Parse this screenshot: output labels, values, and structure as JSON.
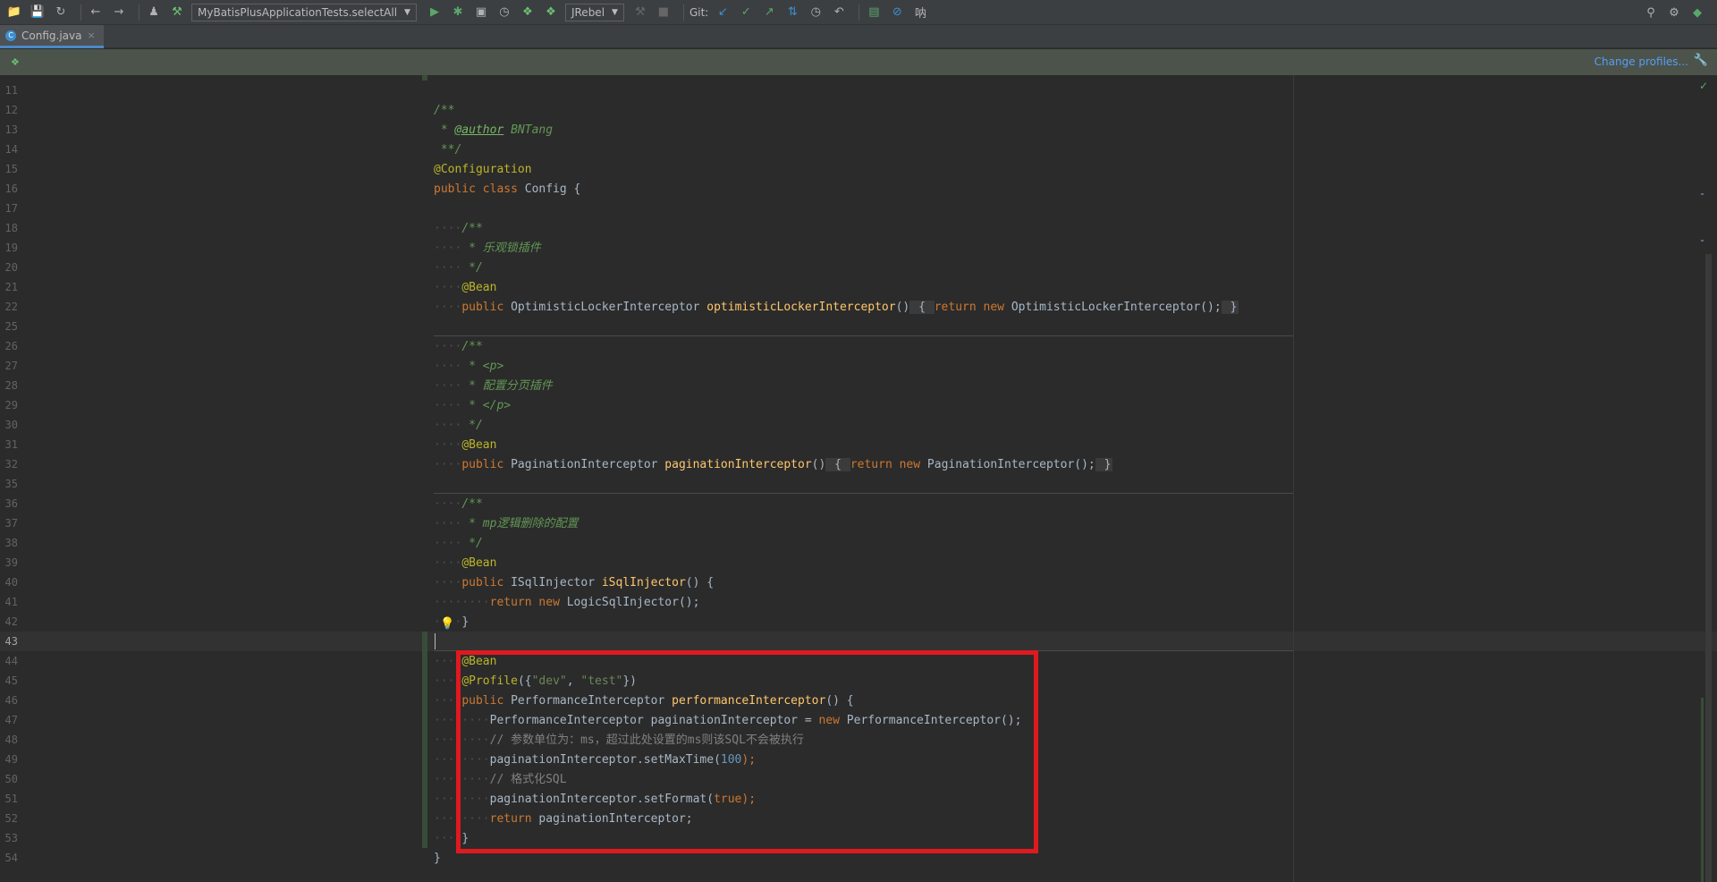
{
  "toolbar": {
    "icons": [
      "folder-icon",
      "save-icon",
      "sync-icon",
      "back-icon",
      "forward-icon",
      "user-icon",
      "build-icon"
    ],
    "run_config": "MyBatisPlusApplicationTests.selectAll",
    "jrebel": "JRebel",
    "git_label": "Git:"
  },
  "tabs": [
    {
      "label": "Config.java",
      "active": true
    }
  ],
  "banner": {
    "link": "Change profiles..."
  },
  "line_numbers": [
    "11",
    "12",
    "13",
    "14",
    "15",
    "16",
    "17",
    "18",
    "19",
    "20",
    "21",
    "22",
    "25",
    "26",
    "27",
    "28",
    "29",
    "30",
    "31",
    "32",
    "35",
    "36",
    "37",
    "38",
    "39",
    "40",
    "41",
    "42",
    "43",
    "44",
    "45",
    "46",
    "47",
    "48",
    "49",
    "50",
    "51",
    "52",
    "53",
    "54"
  ],
  "code": {
    "l12": "/**",
    "l13_star": " * ",
    "l13_tag": "@author",
    "l13_name": " BNTang",
    "l14": " **/",
    "l15": "@Configuration",
    "l16_kw": "public class",
    "l16_rest": " Config {",
    "l18": "/**",
    "l19": " * 乐观锁插件",
    "l20": " */",
    "l21": "@Bean",
    "l22_kw": "public",
    "l22_type": " OptimisticLockerInterceptor ",
    "l22_fn": "optimisticLockerInterceptor",
    "l22_paren": "()",
    "l22_fold_open": " { ",
    "l22_ret": "return new",
    "l22_ctor": " OptimisticLockerInterceptor();",
    "l22_fold_close": " }",
    "l26": "/**",
    "l27": " * <p>",
    "l28": " * 配置分页插件",
    "l29": " * </p>",
    "l30": " */",
    "l31": "@Bean",
    "l32_kw": "public",
    "l32_type": " PaginationInterceptor ",
    "l32_fn": "paginationInterceptor",
    "l32_paren": "()",
    "l32_fold_open": " { ",
    "l32_ret": "return new",
    "l32_ctor": " PaginationInterceptor();",
    "l32_fold_close": " }",
    "l36": "/**",
    "l37": " * mp逻辑删除的配置",
    "l38": " */",
    "l39": "@Bean",
    "l40_kw": "public",
    "l40_type": " ISqlInjector ",
    "l40_fn": "iSqlInjector",
    "l40_rest": "() {",
    "l41_kw": "return new",
    "l41_rest": " LogicSqlInjector();",
    "l42": "}",
    "l44": "@Bean",
    "l45_ann": "@Profile",
    "l45_open": "({",
    "l45_s1": "\"dev\"",
    "l45_comma": ", ",
    "l45_s2": "\"test\"",
    "l45_close": "})",
    "l46_kw": "public",
    "l46_type": " PerformanceInterceptor ",
    "l46_fn": "performanceInterceptor",
    "l46_rest": "() {",
    "l47_type": "PerformanceInterceptor paginationInterceptor = ",
    "l47_kw": "new",
    "l47_rest": " PerformanceInterceptor();",
    "l48": "// 参数单位为：ms，超过此处设置的ms则该SQL不会被执行",
    "l49_a": "paginationInterceptor.setMaxTime(",
    "l49_num": "100",
    "l49_b": ");",
    "l50": "// 格式化SQL",
    "l51_a": "paginationInterceptor.setFormat(",
    "l51_kw": "true",
    "l51_b": ");",
    "l52_kw": "return",
    "l52_rest": " paginationInterceptor;",
    "l53": "}",
    "l54": "}"
  }
}
